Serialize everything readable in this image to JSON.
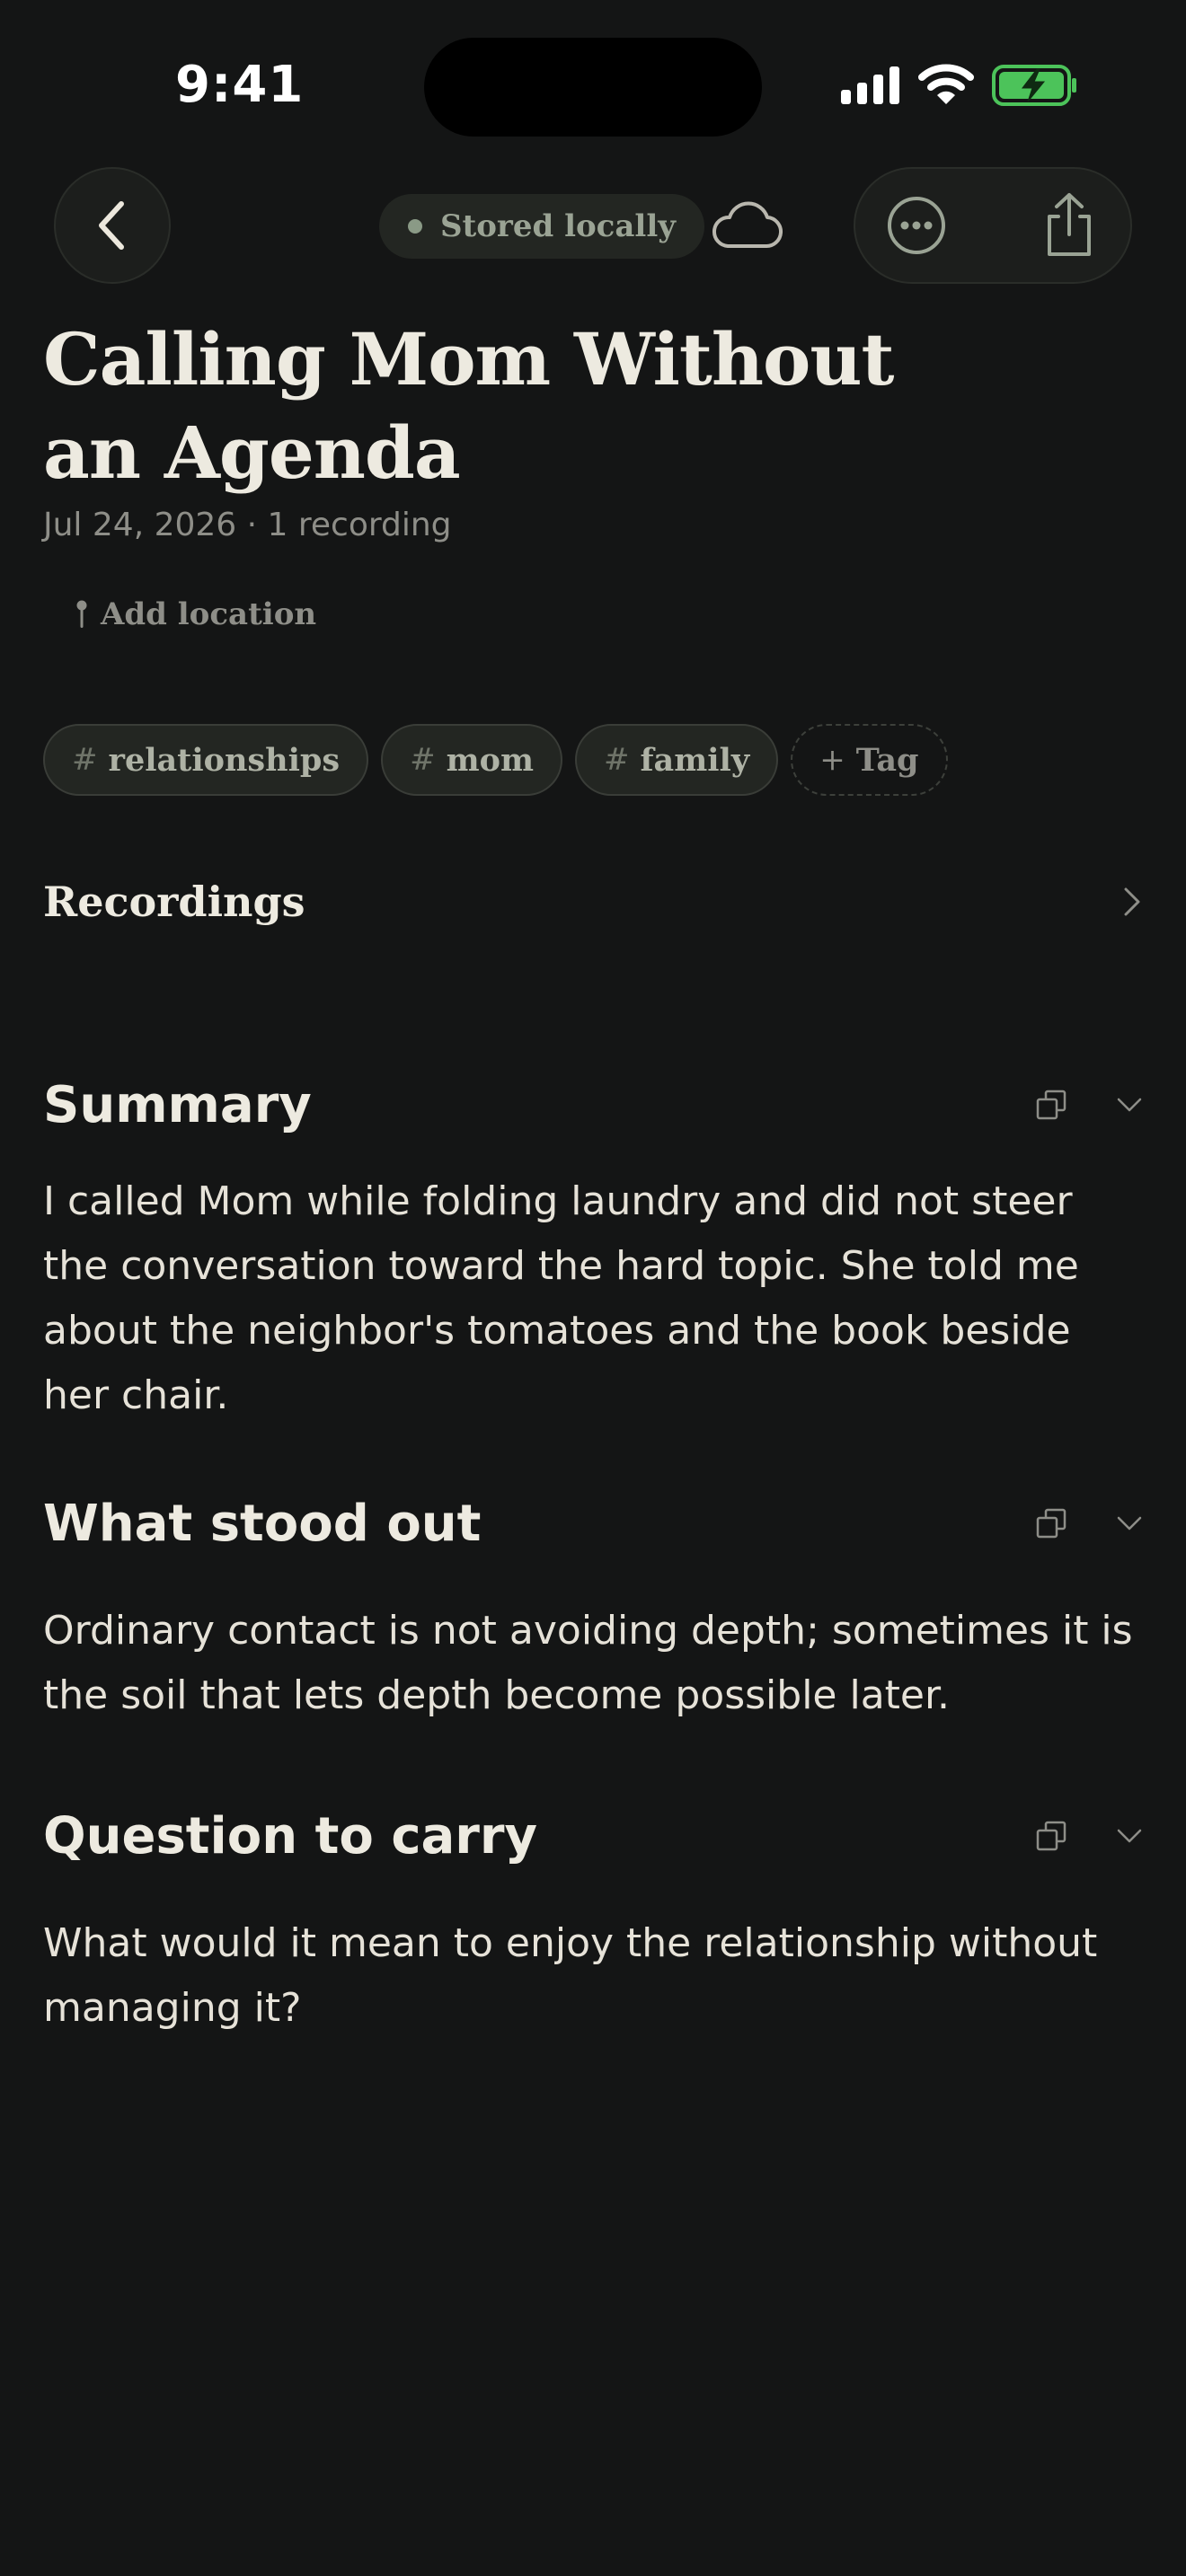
{
  "status_bar": {
    "time": "9:41"
  },
  "nav": {
    "back_icon": "chevron-left-icon",
    "storage_status": "Stored locally",
    "cloud_icon": "cloud-icon",
    "more_icon": "ellipsis-circle-icon",
    "share_icon": "share-icon"
  },
  "entry": {
    "title": "Calling Mom Without an Agenda",
    "meta": "Jul 24, 2026 · 1 recording",
    "add_location": "Add location",
    "tags": [
      {
        "hash": "#",
        "label": "relationships"
      },
      {
        "hash": "#",
        "label": "mom"
      },
      {
        "hash": "#",
        "label": "family"
      }
    ],
    "add_tag": {
      "icon": "+",
      "label": "Tag"
    }
  },
  "recordings": {
    "label": "Recordings"
  },
  "sections": [
    {
      "title": "Summary",
      "body": "I called Mom while folding laundry and did not steer the conversation toward the hard topic. She told me about the neighbor's tomatoes and the book beside her chair."
    },
    {
      "title": "What stood out",
      "body": "Ordinary contact is not avoiding depth; sometimes it is the soil that lets depth become possible later."
    },
    {
      "title": "Question to carry",
      "body": "What would it mean to enjoy the relationship without managing it?"
    }
  ],
  "colors": {
    "background": "#141515",
    "text": "#ECE8DD",
    "muted": "#8e8e88",
    "battery": "#4CC35A"
  }
}
